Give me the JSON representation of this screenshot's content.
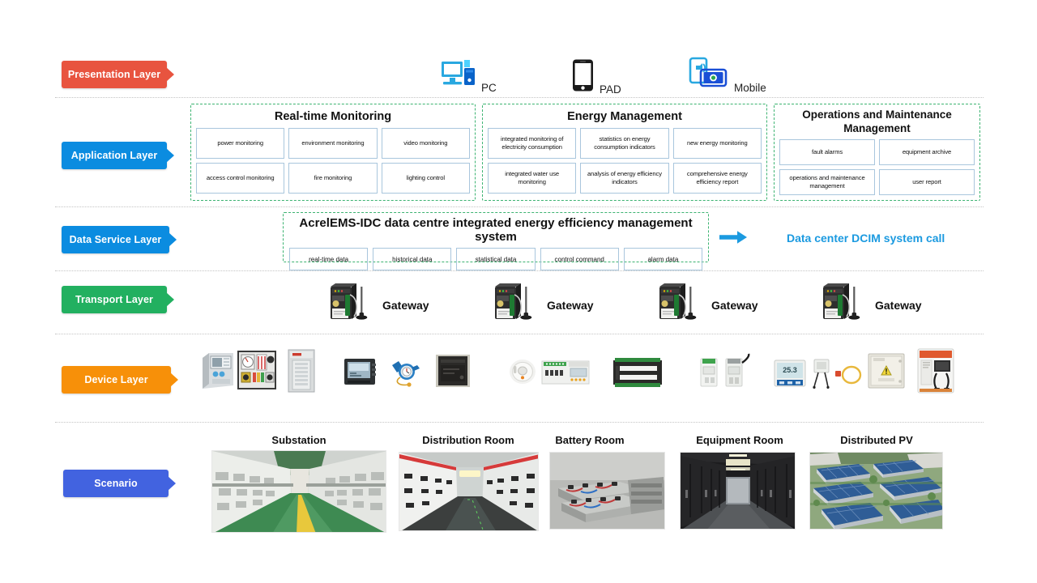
{
  "layers": [
    {
      "id": "presentation",
      "label": "Presentation Layer",
      "color": "#e8543f"
    },
    {
      "id": "application",
      "label": "Application Layer",
      "color": "#0b8ce0"
    },
    {
      "id": "data-service",
      "label": "Data Service Layer",
      "color": "#0b8ce0"
    },
    {
      "id": "transport",
      "label": "Transport Layer",
      "color": "#22b060"
    },
    {
      "id": "device",
      "label": "Device Layer",
      "color": "#f79009"
    },
    {
      "id": "scenario",
      "label": "Scenario",
      "color": "#4263e0"
    }
  ],
  "presentation": {
    "devices": [
      {
        "icon": "desktop-computer-icon",
        "label": "PC"
      },
      {
        "icon": "tablet-icon",
        "label": "PAD"
      },
      {
        "icon": "mobile-devices-icon",
        "label": "Mobile"
      }
    ]
  },
  "application": {
    "groups": [
      {
        "title": "Real-time Monitoring",
        "items": [
          "power monitoring",
          "environment monitoring",
          "video monitoring",
          "access control monitoring",
          "fire monitoring",
          "lighting control"
        ]
      },
      {
        "title": "Energy Management",
        "items": [
          "integrated monitoring of electricity consumption",
          "statistics on energy consumption indicators",
          "new energy monitoring",
          "integrated water use monitoring",
          "analysis of energy efficiency indicators",
          "comprehensive energy efficiency report"
        ]
      },
      {
        "title": "Operations and Maintenance Management",
        "items": [
          "fault alarms",
          "equipment archive",
          "operations and maintenance management",
          "user report"
        ]
      }
    ]
  },
  "data_service": {
    "title": "AcrelEMS-IDC data centre integrated energy efficiency management system",
    "items": [
      "real-time data",
      "historical data",
      "statistical data",
      "control command",
      "alarm data"
    ],
    "call_out": "Data center DCIM system call",
    "call_out_color": "#1b9ae0",
    "arrow_icon": "right-arrow-icon"
  },
  "transport": {
    "gateways": [
      {
        "icon": "gateway-device-icon",
        "label": "Gateway"
      },
      {
        "icon": "gateway-device-icon",
        "label": "Gateway"
      },
      {
        "icon": "gateway-device-icon",
        "label": "Gateway"
      },
      {
        "icon": "gateway-device-icon",
        "label": "Gateway"
      }
    ]
  },
  "device_layer": {
    "devices": [
      {
        "icon": "protection-relay-icon"
      },
      {
        "icon": "switchgear-panel-icon"
      },
      {
        "icon": "distribution-cabinet-icon"
      },
      {
        "icon": "power-meter-icon"
      },
      {
        "icon": "water-meter-icon"
      },
      {
        "icon": "transformer-module-icon"
      },
      {
        "icon": "smoke-detector-icon"
      },
      {
        "icon": "din-rail-controller-icon"
      },
      {
        "icon": "io-module-icon"
      },
      {
        "icon": "circuit-breaker-icon"
      },
      {
        "icon": "wireless-breaker-icon"
      },
      {
        "icon": "temperature-display-icon"
      },
      {
        "icon": "humidity-sensor-icon"
      },
      {
        "icon": "sensor-cable-icon"
      },
      {
        "icon": "control-box-icon"
      },
      {
        "icon": "ev-charging-pile-icon"
      }
    ]
  },
  "scenario": {
    "items": [
      {
        "title": "Substation",
        "photo": "substation-corridor-photo"
      },
      {
        "title": "Distribution Room",
        "photo": "distribution-room-photo"
      },
      {
        "title": "Battery Room",
        "photo": "battery-room-photo"
      },
      {
        "title": "Equipment Room",
        "photo": "server-room-photo"
      },
      {
        "title": "Distributed PV",
        "photo": "rooftop-solar-photo"
      }
    ]
  }
}
